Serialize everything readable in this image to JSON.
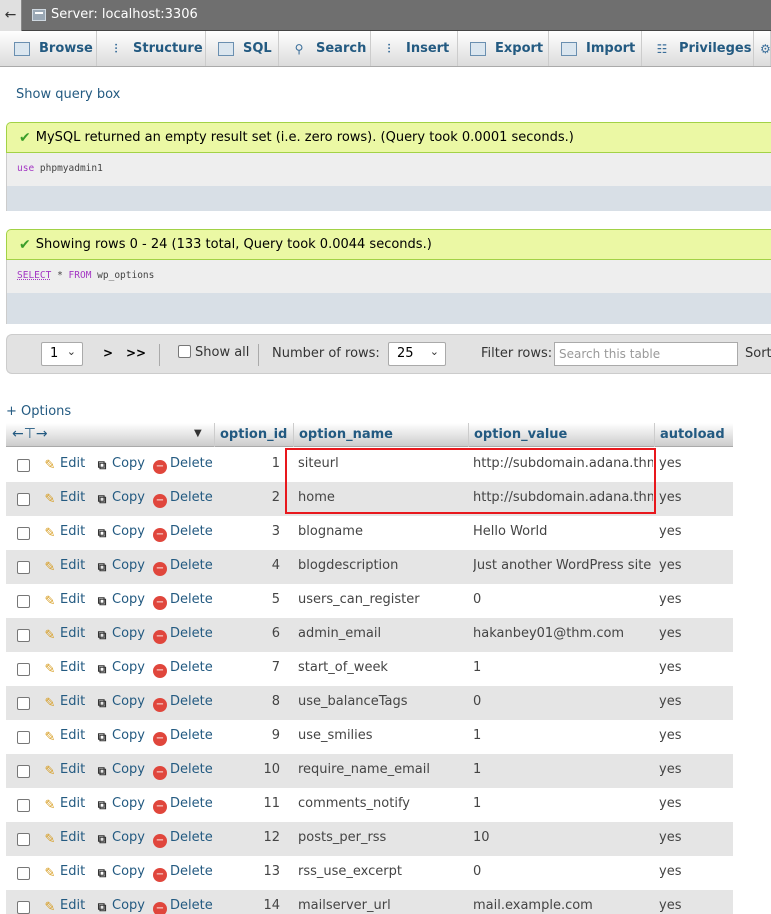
{
  "server": {
    "title": "Server: localhost:3306",
    "back_glyph": "←"
  },
  "tabs": [
    {
      "label": "Browse",
      "icon": "browse-icon"
    },
    {
      "label": "Structure",
      "icon": "structure-icon"
    },
    {
      "label": "SQL",
      "icon": "sql-icon"
    },
    {
      "label": "Search",
      "icon": "search-icon"
    },
    {
      "label": "Insert",
      "icon": "insert-icon"
    },
    {
      "label": "Export",
      "icon": "export-icon"
    },
    {
      "label": "Import",
      "icon": "import-icon"
    },
    {
      "label": "Privileges",
      "icon": "privileges-icon"
    }
  ],
  "show_query_box": "Show query box",
  "notice1": {
    "message": "MySQL returned an empty result set (i.e. zero rows). (Query took 0.0001 seconds.)",
    "sql_kw": "use",
    "sql_rest": "phpmyadmin1"
  },
  "notice2": {
    "message": "Showing rows 0 - 24 (133 total, Query took 0.0044 seconds.)",
    "sql_kw1": "SELECT",
    "sql_mid": "*",
    "sql_kw2": "FROM",
    "sql_rest": "wp_options"
  },
  "nav": {
    "page_select": "1",
    "next": ">",
    "last": ">>",
    "show_all": "Show all",
    "rows_label": "Number of rows:",
    "rows_value": "25",
    "filter_label": "Filter rows:",
    "filter_placeholder": "Search this table",
    "sort_label": "Sort"
  },
  "options_link": "+ Options",
  "table": {
    "columns": [
      "option_id",
      "option_name",
      "option_value",
      "autoload"
    ],
    "actions": {
      "edit": "Edit",
      "copy": "Copy",
      "delete": "Delete"
    },
    "rows": [
      {
        "id": "1",
        "name": "siteurl",
        "value": "http://subdomain.adana.thm",
        "autoload": "yes"
      },
      {
        "id": "2",
        "name": "home",
        "value": "http://subdomain.adana.thm",
        "autoload": "yes"
      },
      {
        "id": "3",
        "name": "blogname",
        "value": "Hello World",
        "autoload": "yes"
      },
      {
        "id": "4",
        "name": "blogdescription",
        "value": "Just another WordPress site",
        "autoload": "yes"
      },
      {
        "id": "5",
        "name": "users_can_register",
        "value": "0",
        "autoload": "yes"
      },
      {
        "id": "6",
        "name": "admin_email",
        "value": "hakanbey01@thm.com",
        "autoload": "yes"
      },
      {
        "id": "7",
        "name": "start_of_week",
        "value": "1",
        "autoload": "yes"
      },
      {
        "id": "8",
        "name": "use_balanceTags",
        "value": "0",
        "autoload": "yes"
      },
      {
        "id": "9",
        "name": "use_smilies",
        "value": "1",
        "autoload": "yes"
      },
      {
        "id": "10",
        "name": "require_name_email",
        "value": "1",
        "autoload": "yes"
      },
      {
        "id": "11",
        "name": "comments_notify",
        "value": "1",
        "autoload": "yes"
      },
      {
        "id": "12",
        "name": "posts_per_rss",
        "value": "10",
        "autoload": "yes"
      },
      {
        "id": "13",
        "name": "rss_use_excerpt",
        "value": "0",
        "autoload": "yes"
      },
      {
        "id": "14",
        "name": "mailserver_url",
        "value": "mail.example.com",
        "autoload": "yes"
      }
    ]
  },
  "colors": {
    "link": "#235a81",
    "notice_bg": "#ebf8a4",
    "highlight": "#e8181d"
  }
}
